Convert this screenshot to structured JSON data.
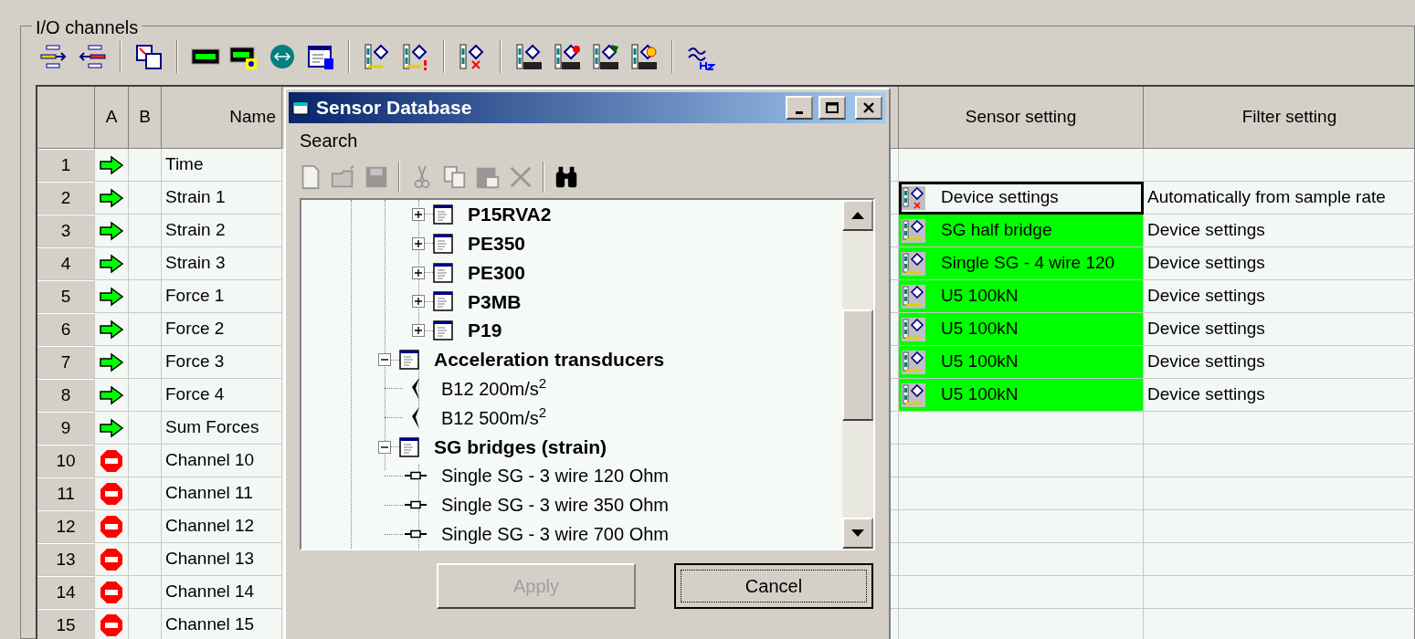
{
  "group_title": "I/O channels",
  "table": {
    "columns": [
      "",
      "A",
      "B",
      "Name",
      "Sensor setting",
      "Filter setting"
    ],
    "rows": [
      {
        "number": "1",
        "active": true,
        "name": "Time"
      },
      {
        "number": "2",
        "active": true,
        "name": "Strain 1",
        "sensor": "Device settings",
        "sensor_assigned": false,
        "selected": true,
        "filter": "Automatically from sample rate"
      },
      {
        "number": "3",
        "active": true,
        "name": "Strain 2",
        "sensor": "SG half bridge",
        "sensor_assigned": true,
        "selected": false,
        "filter": "Device settings"
      },
      {
        "number": "4",
        "active": true,
        "name": "Strain 3",
        "sensor": "Single SG - 4 wire 120",
        "sensor_assigned": true,
        "selected": false,
        "filter": "Device settings"
      },
      {
        "number": "5",
        "active": true,
        "name": "Force 1",
        "sensor": "U5 100kN",
        "sensor_assigned": true,
        "selected": false,
        "filter": "Device settings"
      },
      {
        "number": "6",
        "active": true,
        "name": "Force 2",
        "sensor": "U5 100kN",
        "sensor_assigned": true,
        "selected": false,
        "filter": "Device settings"
      },
      {
        "number": "7",
        "active": true,
        "name": "Force 3",
        "sensor": "U5 100kN",
        "sensor_assigned": true,
        "selected": false,
        "filter": "Device settings"
      },
      {
        "number": "8",
        "active": true,
        "name": "Force 4",
        "sensor": "U5 100kN",
        "sensor_assigned": true,
        "selected": false,
        "filter": "Device settings"
      },
      {
        "number": "9",
        "active": true,
        "name": "Sum Forces"
      },
      {
        "number": "10",
        "active": false,
        "name": "Channel 10"
      },
      {
        "number": "11",
        "active": false,
        "name": "Channel 11"
      },
      {
        "number": "12",
        "active": false,
        "name": "Channel 12"
      },
      {
        "number": "13",
        "active": false,
        "name": "Channel 13"
      },
      {
        "number": "14",
        "active": false,
        "name": "Channel 14"
      },
      {
        "number": "15",
        "active": false,
        "name": "Channel 15"
      }
    ]
  },
  "dialog": {
    "title": "Sensor Database",
    "menu": [
      "Search"
    ],
    "toolbar": [
      {
        "disabled": true
      },
      {
        "disabled": true
      },
      {
        "disabled": true
      },
      {
        "disabled": true
      },
      {
        "disabled": true
      },
      {
        "disabled": true
      },
      {
        "disabled": true
      },
      {
        "disabled": false
      }
    ],
    "tree": [
      {
        "children": [
          {
            "children": [
              {
                "children": [
                  {
                    "label": "P15RVA2",
                    "kind": "group",
                    "expanded": false
                  },
                  {
                    "label": "PE350",
                    "kind": "group",
                    "expanded": false
                  },
                  {
                    "label": "PE300",
                    "kind": "group",
                    "expanded": false
                  },
                  {
                    "label": "P3MB",
                    "kind": "group",
                    "expanded": false
                  },
                  {
                    "label": "P19",
                    "kind": "group",
                    "expanded": false
                  }
                ]
              },
              {
                "label": "Acceleration transducers",
                "kind": "group",
                "expanded": true,
                "children": [
                  {
                    "label": "B12 200m/s$^{2}$",
                    "kind": "accelerometer"
                  },
                  {
                    "label": "B12 500m/s$^{2}$",
                    "kind": "accelerometer"
                  }
                ]
              },
              {
                "label": "SG bridges (strain)",
                "kind": "group",
                "expanded": true,
                "children": [
                  {
                    "label": "Single SG - 3 wire 120 Ohm",
                    "kind": "strain_gauge"
                  },
                  {
                    "label": "Single SG - 3 wire 350 Ohm",
                    "kind": "strain_gauge"
                  },
                  {
                    "label": "Single SG - 3 wire 700 Ohm",
                    "kind": "strain_gauge"
                  }
                ]
              }
            ]
          }
        ]
      }
    ],
    "buttons": [
      {
        "label": "Apply",
        "disabled": true,
        "default": false
      },
      {
        "label": "Cancel",
        "disabled": false,
        "default": true
      }
    ]
  }
}
